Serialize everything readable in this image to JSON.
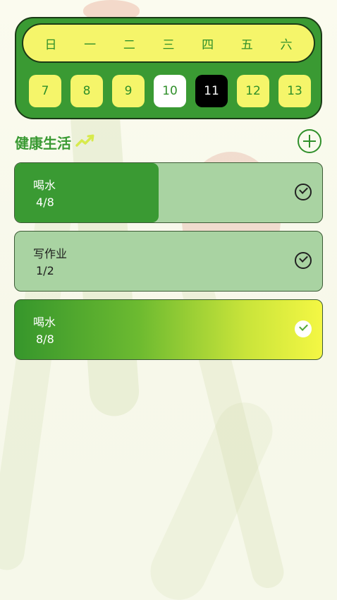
{
  "calendar": {
    "weekdays": [
      "日",
      "一",
      "二",
      "三",
      "四",
      "五",
      "六"
    ],
    "dates": [
      "7",
      "8",
      "9",
      "10",
      "11",
      "12",
      "13"
    ],
    "today": "10",
    "selected": "11"
  },
  "section": {
    "title": "健康生活",
    "icon": "trend-up-icon",
    "add_icon": "plus-circle-icon"
  },
  "habits": [
    {
      "name": "喝水",
      "count": "4/8",
      "progress": 0.5,
      "completed": false
    },
    {
      "name": "写作业",
      "count": "1/2",
      "progress": 0,
      "completed": false
    },
    {
      "name": "喝水",
      "count": "8/8",
      "progress": 1,
      "completed": true
    }
  ],
  "colors": {
    "accent_green": "#3a9a33",
    "accent_yellow": "#f5f56a",
    "card_bg": "#a9d3a2"
  }
}
